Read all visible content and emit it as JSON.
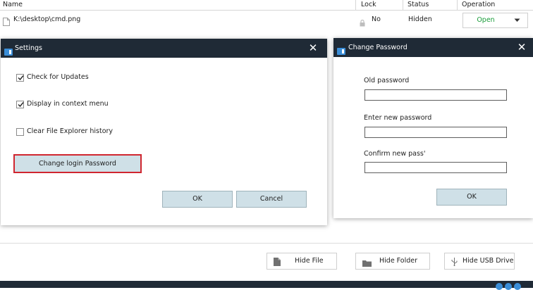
{
  "table": {
    "headers": {
      "name": "Name",
      "lock": "Lock",
      "status": "Status",
      "operation": "Operation"
    },
    "rows": [
      {
        "name": "K:\\desktop\\cmd.png",
        "lock": "No",
        "status": "Hidden",
        "operation": "Open"
      }
    ]
  },
  "settings": {
    "title": "Settings",
    "options": [
      {
        "label": "Check for Updates",
        "checked": true
      },
      {
        "label": "Display in context menu",
        "checked": true
      },
      {
        "label": "Clear File Explorer history",
        "checked": false
      }
    ],
    "change_password_label": "Change login Password",
    "ok_label": "OK",
    "cancel_label": "Cancel"
  },
  "change_password": {
    "title": "Change Password",
    "old_label": "Old password",
    "new_label": "Enter new password",
    "confirm_label": "Confirm new pass'",
    "ok_label": "OK"
  },
  "actions": {
    "hide_file": "Hide File",
    "hide_folder": "Hide Folder",
    "hide_usb": "Hide USB Drive"
  },
  "colors": {
    "title_bar": "#1f2a36",
    "button_bg": "#cfe0e7",
    "open_text": "#1a9c3a",
    "highlight_border": "#d0262f"
  }
}
